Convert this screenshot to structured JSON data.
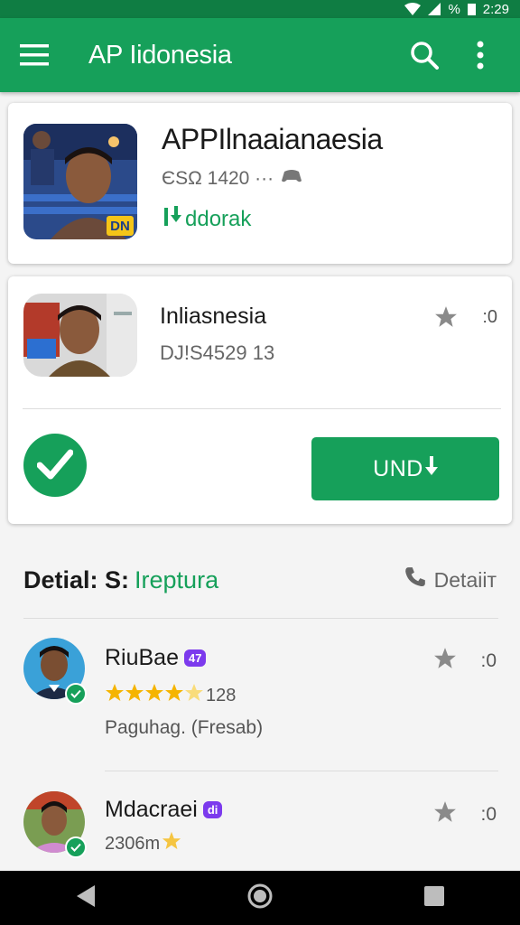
{
  "status_bar": {
    "time": "2:29",
    "battery": "%"
  },
  "app_bar": {
    "title": "AP Iidonesia",
    "icons": [
      "menu-icon",
      "search-icon",
      "more-vert-icon"
    ]
  },
  "card1": {
    "title": "APPIlnaaianaesia",
    "meta": "ЄSΩ 1420 ···",
    "download_label": "ddorak",
    "thumb_badge": "DN"
  },
  "card2": {
    "title": "Inliasnesia",
    "subtitle": "DJ!S4529 13",
    "rating_count": ":0",
    "install_label": "UND",
    "icons": [
      "check-icon",
      "star-icon",
      "download-icon"
    ]
  },
  "details": {
    "label": "Detial: S:",
    "value": "Ireptura",
    "right_label": "Detaiiт"
  },
  "reviews": [
    {
      "name": "RiuBae",
      "tag": "47",
      "rating_stars": 4.5,
      "rating_text": "128",
      "subtitle": "Paguhag. (Fresab)",
      "count": ":0"
    },
    {
      "name": "Mdacraei",
      "tag": "di",
      "rating_text": "2306m",
      "subtitle": "",
      "count": ":0"
    }
  ],
  "colors": {
    "primary": "#16a05a",
    "status_bar": "#0f7d43",
    "tag": "#7c3aed",
    "star": "#f5b400"
  }
}
